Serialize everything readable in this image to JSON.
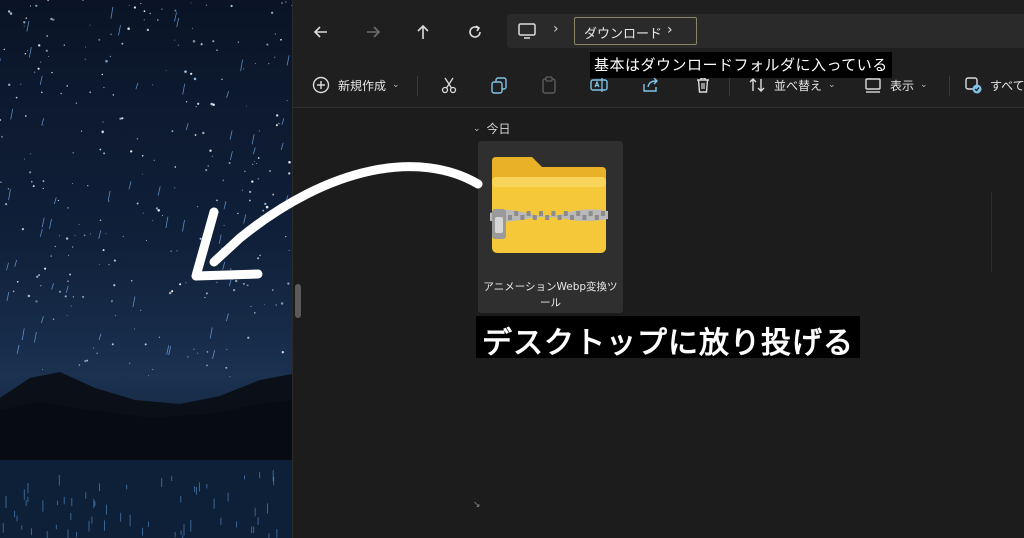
{
  "breadcrumb": {
    "current": "ダウンロード"
  },
  "toolbar": {
    "new_label": "新規作成",
    "sort_label": "並べ替え",
    "view_label": "表示",
    "select_all_label": "すべて選"
  },
  "content": {
    "group_header": "今日",
    "file": {
      "name": "アニメーションWebp変換ツール",
      "icon": "zip-folder-icon"
    }
  },
  "annotations": {
    "top_caption": "基本はダウンロードフォルダに入っている",
    "main_caption": "デスクトップに放り投げる"
  },
  "colors": {
    "folder_yellow": "#f5c83a",
    "window_bg": "#1c1c1c",
    "annotation_bg": "#000000"
  }
}
